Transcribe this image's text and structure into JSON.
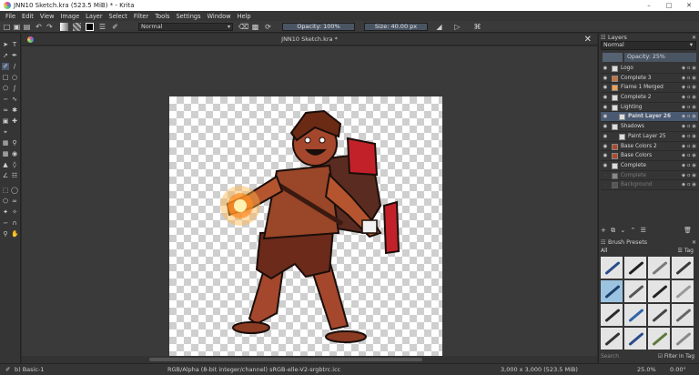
{
  "window": {
    "title": "JNN10 Sketch.kra (523.5 MiB)  * - Krita",
    "controls": [
      "–",
      "□",
      "✕"
    ]
  },
  "menu": [
    "File",
    "Edit",
    "View",
    "Image",
    "Layer",
    "Select",
    "Filter",
    "Tools",
    "Settings",
    "Window",
    "Help"
  ],
  "toolbar": {
    "blend_mode": "Normal",
    "opacity": "Opacity: 100%",
    "size": "Size: 40.00 px",
    "fg_color": "#000000",
    "bg_color": "#ffffff"
  },
  "document": {
    "tab_title": "JNN10 Sketch.kra *"
  },
  "layers_docker": {
    "title": "Layers",
    "blend_mode": "Normal",
    "opacity": "Opacity:  25%",
    "layers": [
      {
        "name": "Logo",
        "visible": true,
        "selected": false,
        "dim": false
      },
      {
        "name": "Complete 3",
        "visible": true,
        "selected": false,
        "dim": false
      },
      {
        "name": "Flame 1 Merged",
        "visible": true,
        "selected": false,
        "dim": false
      },
      {
        "name": "Complete 2",
        "visible": true,
        "selected": false,
        "dim": false
      },
      {
        "name": "Lighting",
        "visible": true,
        "selected": false,
        "dim": false
      },
      {
        "name": "Paint Layer 26",
        "visible": true,
        "selected": true,
        "dim": false
      },
      {
        "name": "Shadows",
        "visible": true,
        "selected": false,
        "dim": false
      },
      {
        "name": "Paint Layer 25",
        "visible": true,
        "selected": false,
        "dim": false
      },
      {
        "name": "Base Colors 2",
        "visible": true,
        "selected": false,
        "dim": false
      },
      {
        "name": "Base Colors",
        "visible": true,
        "selected": false,
        "dim": false
      },
      {
        "name": "Complete",
        "visible": true,
        "selected": false,
        "dim": false
      },
      {
        "name": "Complete",
        "visible": false,
        "selected": false,
        "dim": true
      },
      {
        "name": "Background",
        "visible": false,
        "selected": false,
        "dim": true
      }
    ]
  },
  "brush_presets": {
    "title": "Brush Presets",
    "filter": "All",
    "tag_label": "Tag",
    "search_placeholder": "Search",
    "filter_in_tag": "Filter in Tag"
  },
  "status": {
    "brush": "b) Basic-1",
    "color_info": "RGB/Alpha (8-bit integer/channel)  sRGB-elle-V2-srgbtrc.icc",
    "image_size": "3,000 x 3,000 (523.5 MiB)",
    "zoom": "25.0%",
    "rotation": "0.00°"
  }
}
